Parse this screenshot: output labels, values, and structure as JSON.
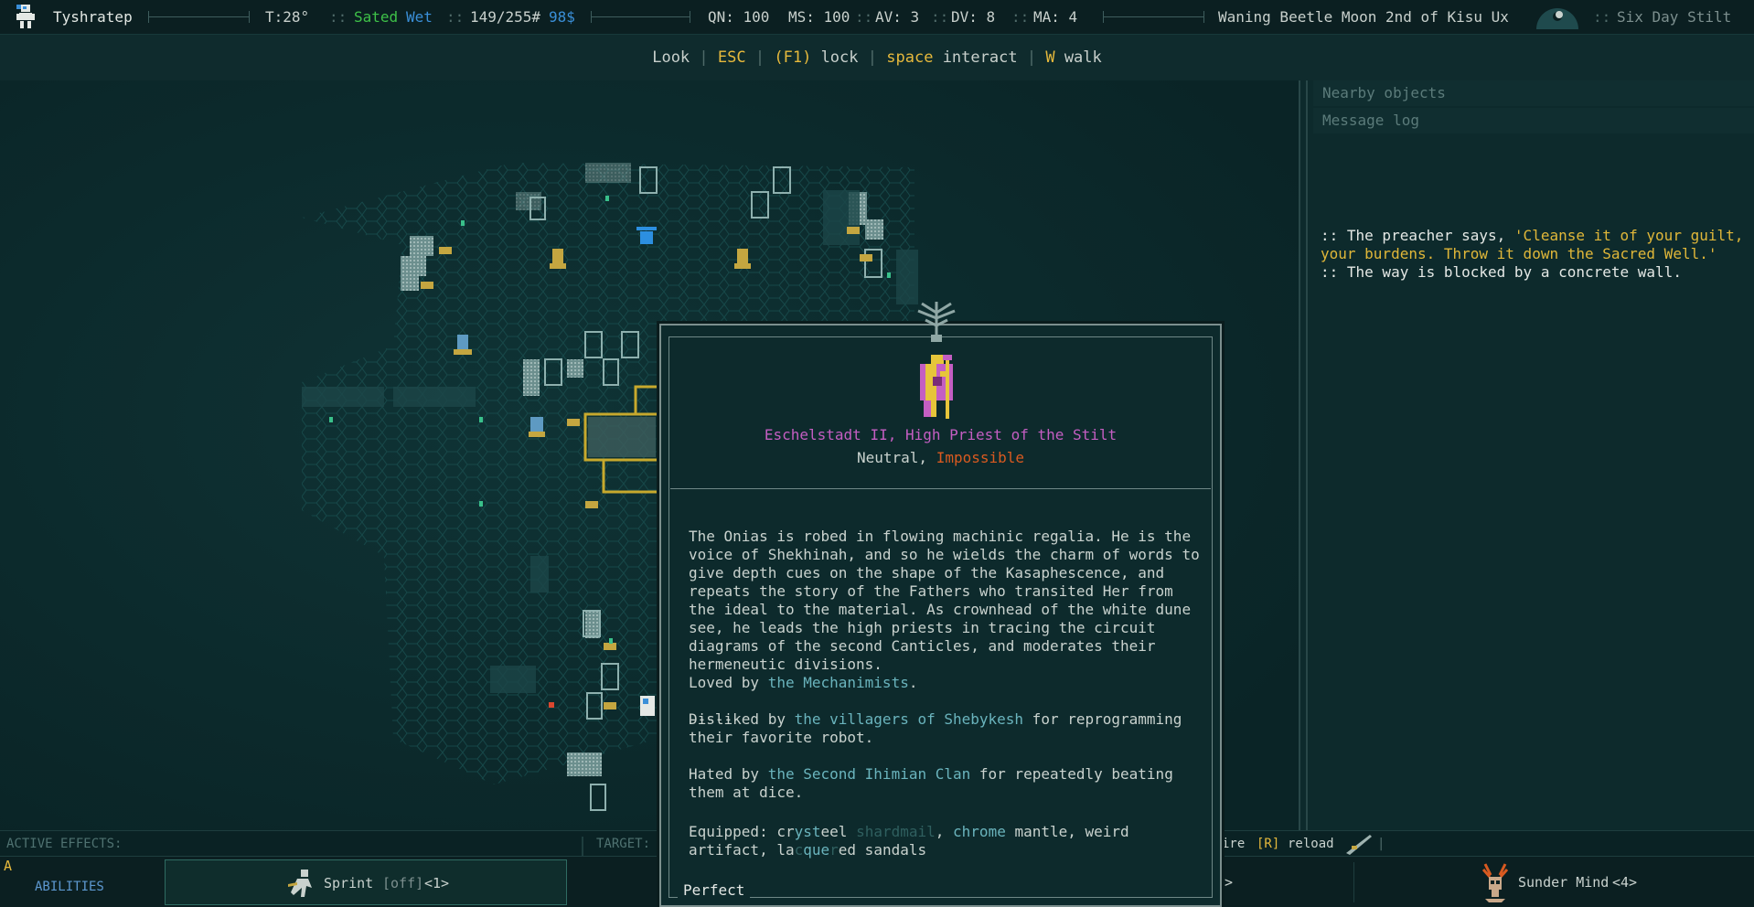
{
  "topbar": {
    "player_name": "Tyshratep",
    "temperature": "T:28°",
    "hunger": "Sated",
    "wetness": "Wet",
    "hp": "149/255#",
    "money": "98$",
    "qn": "QN: 100",
    "ms": "MS: 100",
    "av": "AV: 3",
    "dv": "DV: 8",
    "ma": "MA: 4",
    "date": "Waning Beetle Moon 2nd of Kisu Ux",
    "location": "Six Day Stilt"
  },
  "hints": {
    "look": "Look",
    "esc": "ESC",
    "lock_key": "(F1)",
    "lock": "lock",
    "interact_key": "space",
    "interact": "interact",
    "walk_key": "W",
    "walk": "walk"
  },
  "right_panel": {
    "nearby_title": "Nearby objects",
    "log_title": "Message log",
    "messages": [
      {
        "prefix": ":: The preacher says, ",
        "quote": "'Cleanse it of your guilt, your burdens. Throw it down the Sacred Well.'"
      },
      {
        "prefix": ":: The way is blocked by a concrete wall.",
        "quote": ""
      }
    ]
  },
  "popup": {
    "name": "Eschelstadt II, High Priest of the Stilt",
    "alignment": "Neutral,",
    "difficulty": "Impossible",
    "description": "The Onias is robed in flowing machinic regalia. He is the voice of Shekhinah, and so he wields the charm of words to give depth cues on the shape of the Kasaphescence, and repeats the story of the Fathers who transited Her from the ideal to the material. As crownhead of the white dune see, he leads the high priests in tracing the circuit diagrams of the second Canticles, and moderates their hermeneutic divisions.",
    "separator": "-----",
    "loved_prefix": "Loved by ",
    "loved_faction": "the Mechanimists",
    "loved_suffix": ".",
    "disliked_prefix": "Disliked by ",
    "disliked_faction": "the villagers of Shebykesh",
    "disliked_suffix": " for reprogramming their favorite robot.",
    "hated_prefix": "Hated by ",
    "hated_faction": "the Second Ihimian Clan",
    "hated_suffix": " for repeatedly beating them at dice.",
    "equipped_label": "Equipped:",
    "equip_1a": "cr",
    "equip_1b": "yst",
    "equip_1c": "eel",
    "equip_1d": "shardmail",
    "equip_2": "chrome",
    "equip_2b": " mantle, weird artifact, ",
    "equip_3a": "la",
    "equip_3b": "c",
    "equip_3c": "que",
    "equip_3d": "r",
    "equip_3e": "ed sandals",
    "condition": "Perfect"
  },
  "bottom": {
    "active_effects": "ACTIVE EFFECTS:",
    "target": "TARGET:",
    "fire_tail": "ire",
    "reload_key": "[R]",
    "reload": "reload",
    "ability_hotkey": "A",
    "abilities_label": "ABILITIES",
    "sprint_label": "Sprint",
    "sprint_state": "[off]",
    "sprint_key": "<1>",
    "slot_arrow": ">",
    "sunder_label": "Sunder Mind",
    "sunder_key": "<4>"
  },
  "colors": {
    "background": "#0c2a2b",
    "faction": "#6ab4bd",
    "npc_name": "#c45ec2",
    "difficulty": "#d95a20",
    "quote": "#e0b739"
  }
}
